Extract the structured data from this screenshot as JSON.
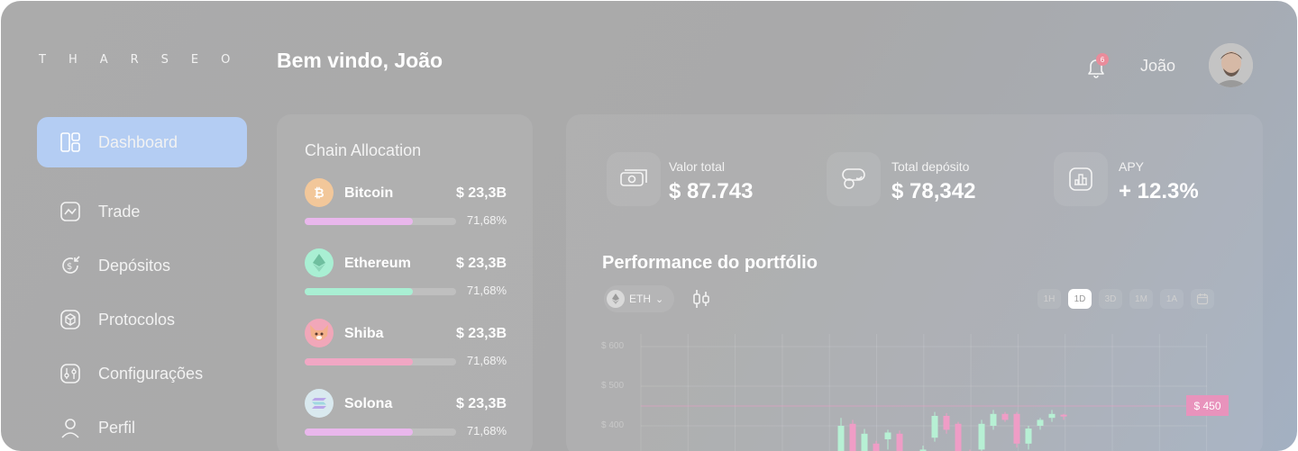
{
  "brand": {
    "logo": "THARSEO"
  },
  "header": {
    "welcome": "Bem vindo, João",
    "notification_count": "6",
    "username": "João"
  },
  "sidebar": {
    "items": [
      {
        "label": "Dashboard",
        "icon": "dashboard-icon",
        "active": true
      },
      {
        "label": "Trade",
        "icon": "trade-chart-icon",
        "active": false
      },
      {
        "label": "Depósitos",
        "icon": "deposit-dollar-icon",
        "active": false
      },
      {
        "label": "Protocolos",
        "icon": "cube-icon",
        "active": false
      },
      {
        "label": "Configurações",
        "icon": "settings-sliders-icon",
        "active": false
      },
      {
        "label": "Perfil",
        "icon": "user-icon",
        "active": false
      }
    ]
  },
  "chain_allocation": {
    "title": "Chain Allocation",
    "coins": [
      {
        "name": "Bitcoin",
        "value": "$ 23,3B",
        "percent": "71,68%",
        "progress": 0.7168,
        "color": "#e9b7ec",
        "icon": "bitcoin-icon"
      },
      {
        "name": "Ethereum",
        "value": "$ 23,3B",
        "percent": "71,68%",
        "progress": 0.7168,
        "color": "#a9efd3",
        "icon": "ethereum-icon"
      },
      {
        "name": "Shiba",
        "value": "$ 23,3B",
        "percent": "71,68%",
        "progress": 0.7168,
        "color": "#f1a7c4",
        "icon": "shiba-icon"
      },
      {
        "name": "Solona",
        "value": "$ 23,3B",
        "percent": "71,68%",
        "progress": 0.7168,
        "color": "#e9b7ec",
        "icon": "solana-icon"
      }
    ]
  },
  "stats": [
    {
      "label": "Valor total",
      "value": "$ 87.743",
      "icon": "cash-icon"
    },
    {
      "label": "Total depósito",
      "value": "$ 78,342",
      "icon": "coins-hand-icon"
    },
    {
      "label": "APY",
      "value": "+ 12.3%",
      "icon": "bar-chart-icon"
    }
  ],
  "performance": {
    "title": "Performance do portfólio",
    "asset_selector": "ETH",
    "timeframes": [
      "1H",
      "1D",
      "3D",
      "1M",
      "1A"
    ],
    "active_timeframe": "1D",
    "price_tag": "$ 450"
  },
  "chart_data": {
    "type": "candlestick",
    "y_tick_labels": [
      "$ 600",
      "$ 500",
      "$ 400"
    ],
    "y_ticks": [
      600,
      500,
      400
    ],
    "current_price": 450,
    "colors": {
      "up": "#b7f0d4",
      "down": "#ef9dc6"
    },
    "candles": [
      {
        "open": 308,
        "close": 400,
        "high": 420,
        "low": 290,
        "dir": "up"
      },
      {
        "open": 405,
        "close": 320,
        "high": 415,
        "low": 300,
        "dir": "down"
      },
      {
        "open": 330,
        "close": 380,
        "high": 392,
        "low": 320,
        "dir": "up"
      },
      {
        "open": 355,
        "close": 312,
        "high": 362,
        "low": 300,
        "dir": "down"
      },
      {
        "open": 366,
        "close": 383,
        "high": 390,
        "low": 340,
        "dir": "up"
      },
      {
        "open": 380,
        "close": 330,
        "high": 388,
        "low": 320,
        "dir": "down"
      },
      {
        "open": 300,
        "close": 320,
        "high": 330,
        "low": 290,
        "dir": "up"
      },
      {
        "open": 320,
        "close": 340,
        "high": 350,
        "low": 300,
        "dir": "up"
      },
      {
        "open": 370,
        "close": 425,
        "high": 435,
        "low": 360,
        "dir": "up"
      },
      {
        "open": 425,
        "close": 390,
        "high": 432,
        "low": 380,
        "dir": "down"
      },
      {
        "open": 405,
        "close": 330,
        "high": 410,
        "low": 320,
        "dir": "down"
      },
      {
        "open": 320,
        "close": 295,
        "high": 340,
        "low": 285,
        "dir": "down"
      },
      {
        "open": 340,
        "close": 405,
        "high": 415,
        "low": 330,
        "dir": "up"
      },
      {
        "open": 400,
        "close": 430,
        "high": 440,
        "low": 390,
        "dir": "up"
      },
      {
        "open": 430,
        "close": 415,
        "high": 435,
        "low": 410,
        "dir": "down"
      },
      {
        "open": 430,
        "close": 355,
        "high": 435,
        "low": 345,
        "dir": "down"
      },
      {
        "open": 355,
        "close": 393,
        "high": 400,
        "low": 340,
        "dir": "up"
      },
      {
        "open": 400,
        "close": 415,
        "high": 420,
        "low": 390,
        "dir": "up"
      },
      {
        "open": 420,
        "close": 430,
        "high": 440,
        "low": 410,
        "dir": "up"
      },
      {
        "open": 428,
        "close": 425,
        "high": 430,
        "low": 415,
        "dir": "down"
      }
    ]
  }
}
